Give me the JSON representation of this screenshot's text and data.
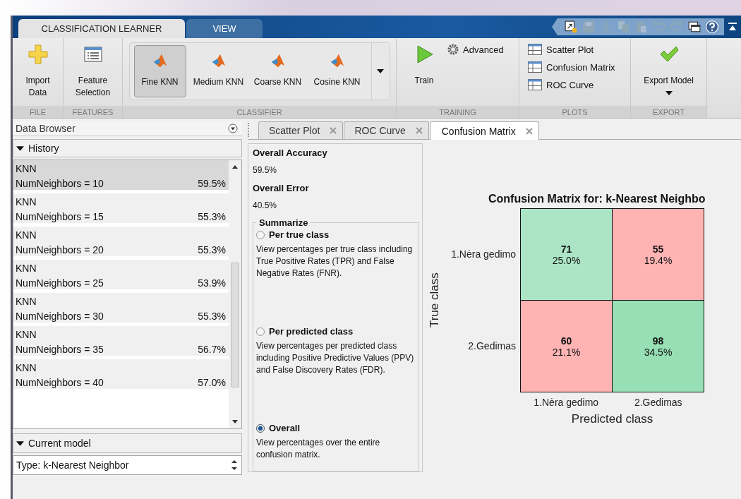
{
  "ribbon_tabs": [
    {
      "label": "CLASSIFICATION LEARNER",
      "selected": true
    },
    {
      "label": "VIEW",
      "selected": false
    }
  ],
  "file": {
    "title": "FILE",
    "button": "Import Data"
  },
  "features": {
    "title": "FEATURES",
    "button": "Feature Selection"
  },
  "classifier": {
    "title": "CLASSIFIER",
    "models": [
      {
        "label": "Fine KNN",
        "selected": true
      },
      {
        "label": "Medium KNN",
        "selected": false
      },
      {
        "label": "Coarse KNN",
        "selected": false
      },
      {
        "label": "Cosine KNN",
        "selected": false
      }
    ]
  },
  "training": {
    "title": "TRAINING",
    "train": "Train",
    "advanced": "Advanced"
  },
  "plots": {
    "title": "PLOTS",
    "items": [
      "Scatter Plot",
      "Confusion Matrix",
      "ROC Curve"
    ]
  },
  "export": {
    "title": "EXPORT",
    "button": "Export Model"
  },
  "data_browser": {
    "title": "Data Browser",
    "history": {
      "title": "History",
      "expanded": true,
      "items": [
        {
          "name": "KNN",
          "detail": "NumNeighbors = 10",
          "accuracy": "59.5%",
          "selected": true
        },
        {
          "name": "KNN",
          "detail": "NumNeighbors = 15",
          "accuracy": "55.3%",
          "selected": false
        },
        {
          "name": "KNN",
          "detail": "NumNeighbors = 20",
          "accuracy": "55.3%",
          "selected": false
        },
        {
          "name": "KNN",
          "detail": "NumNeighbors = 25",
          "accuracy": "53.9%",
          "selected": false
        },
        {
          "name": "KNN",
          "detail": "NumNeighbors = 30",
          "accuracy": "55.3%",
          "selected": false
        },
        {
          "name": "KNN",
          "detail": "NumNeighbors = 35",
          "accuracy": "56.7%",
          "selected": false
        },
        {
          "name": "KNN",
          "detail": "NumNeighbors = 40",
          "accuracy": "57.0%",
          "selected": false
        }
      ]
    },
    "current_model": {
      "title": "Current model",
      "expanded": true,
      "value": "Type: k-Nearest Neighbor"
    }
  },
  "document_tabs": [
    {
      "label": "Scatter Plot",
      "selected": false
    },
    {
      "label": "ROC Curve",
      "selected": false
    },
    {
      "label": "Confusion Matrix",
      "selected": true
    }
  ],
  "summary": {
    "accuracy_label": "Overall Accuracy",
    "accuracy": "59.5%",
    "error_label": "Overall Error",
    "error": "40.5%",
    "summarize": {
      "title": "Summarize",
      "options": [
        {
          "label": "Per true class",
          "description": "View percentages per true class including True Positive Rates (TPR) and False Negative Rates (FNR).",
          "selected": false
        },
        {
          "label": "Per predicted class",
          "description": "View percentages per predicted class including Positive Predictive Values (PPV) and False Discovery Rates (FDR).",
          "selected": false
        },
        {
          "label": "Overall",
          "description": "View percentages over the entire confusion matrix.",
          "selected": true
        }
      ]
    }
  },
  "confusion_matrix": {
    "title": "Confusion Matrix for: k-Nearest Neighbo",
    "ylabel": "True class",
    "xlabel": "Predicted class",
    "row_labels": [
      "1.Nėra gedimo",
      "2.Gedimas"
    ],
    "col_labels": [
      "1.Nėra gedimo",
      "2.Gedimas"
    ],
    "cells": [
      [
        {
          "count": "71",
          "percent": "25.0%",
          "color": "#ace5c6"
        },
        {
          "count": "55",
          "percent": "19.4%",
          "color": "#ffb3b3"
        }
      ],
      [
        {
          "count": "60",
          "percent": "21.1%",
          "color": "#ffb3b3"
        },
        {
          "count": "98",
          "percent": "34.5%",
          "color": "#97dfb5"
        }
      ]
    ]
  }
}
